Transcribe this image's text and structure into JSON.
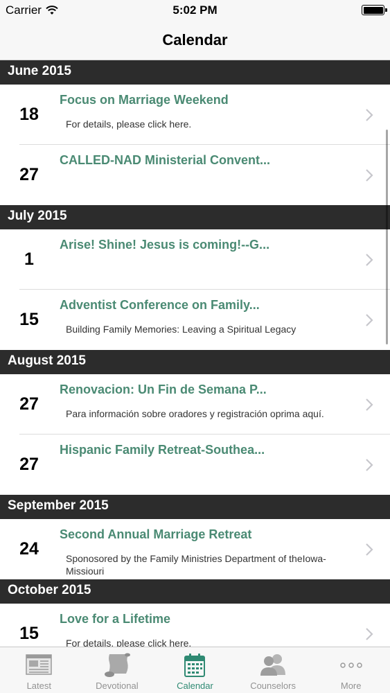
{
  "status_bar": {
    "carrier": "Carrier",
    "time": "5:02 PM"
  },
  "nav": {
    "title": "Calendar"
  },
  "sections": [
    {
      "header": "June 2015",
      "events": [
        {
          "day": "18",
          "title": "Focus on Marriage Weekend",
          "description": "For details, please click here."
        },
        {
          "day": "27",
          "title": "CALLED-NAD Ministerial Convent...",
          "description": ""
        }
      ]
    },
    {
      "header": "July 2015",
      "events": [
        {
          "day": "1",
          "title": "Arise! Shine! Jesus is coming!--G...",
          "description": ""
        },
        {
          "day": "15",
          "title": "Adventist Conference on Family...",
          "description": "Building Family Memories: Leaving a Spiritual Legacy"
        }
      ]
    },
    {
      "header": "August 2015",
      "events": [
        {
          "day": "27",
          "title": "Renovacion: Un Fin de Semana P...",
          "description": "Para información sobre oradores y registración oprima aquí."
        },
        {
          "day": "27",
          "title": "Hispanic Family Retreat-Southea...",
          "description": ""
        }
      ]
    },
    {
      "header": "September 2015",
      "events": [
        {
          "day": "24",
          "title": "Second Annual Marriage Retreat",
          "description": "Sponosored by the Family Ministries Department of theIowa-Missiouri"
        }
      ]
    },
    {
      "header": "October 2015",
      "events": [
        {
          "day": "15",
          "title": "Love for a Lifetime",
          "description": "For details, please click here."
        }
      ]
    }
  ],
  "tabs": [
    {
      "label": "Latest",
      "icon": "newspaper-icon",
      "active": false
    },
    {
      "label": "Devotional",
      "icon": "scroll-icon",
      "active": false
    },
    {
      "label": "Calendar",
      "icon": "calendar-icon",
      "active": true
    },
    {
      "label": "Counselors",
      "icon": "people-icon",
      "active": false
    },
    {
      "label": "More",
      "icon": "more-dots-icon",
      "active": false
    }
  ],
  "colors": {
    "accent": "#2f8a73",
    "event_title": "#4a8a73",
    "section_header_bg": "#2c2c2c",
    "tab_inactive": "#929292"
  }
}
